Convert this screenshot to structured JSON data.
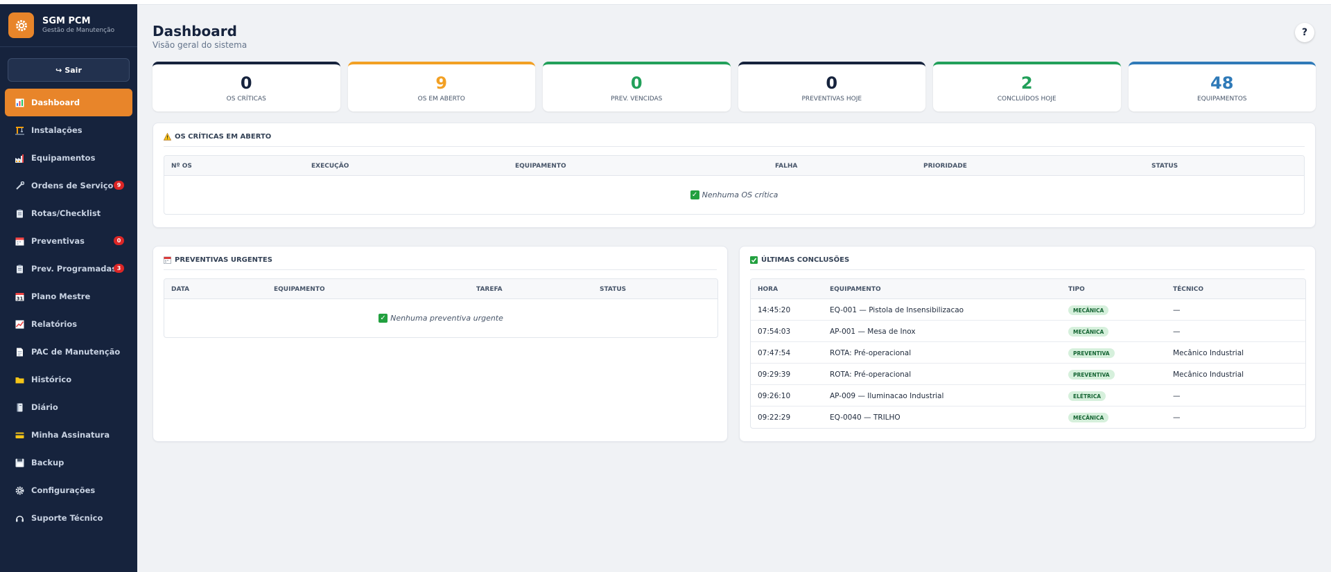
{
  "brand": {
    "title": "SGM PCM",
    "subtitle": "Gestão de Manutenção"
  },
  "logout_label": "Sair",
  "nav": [
    {
      "label": "Dashboard",
      "icon": "bar-chart-icon",
      "active": true
    },
    {
      "label": "Instalações",
      "icon": "crane-icon"
    },
    {
      "label": "Equipamentos",
      "icon": "factory-icon"
    },
    {
      "label": "Ordens de Serviço",
      "icon": "wrench-icon",
      "badge": "9"
    },
    {
      "label": "Rotas/Checklist",
      "icon": "clipboard-icon"
    },
    {
      "label": "Preventivas",
      "icon": "calendar-icon",
      "badge": "0"
    },
    {
      "label": "Prev. Programadas",
      "icon": "clipboard-icon",
      "badge": "3"
    },
    {
      "label": "Plano Mestre",
      "icon": "calendar-31-icon"
    },
    {
      "label": "Relatórios",
      "icon": "line-chart-icon"
    },
    {
      "label": "PAC de Manutenção",
      "icon": "document-icon"
    },
    {
      "label": "Histórico",
      "icon": "folder-icon"
    },
    {
      "label": "Diário",
      "icon": "notebook-icon"
    },
    {
      "label": "Minha Assinatura",
      "icon": "credit-card-icon"
    },
    {
      "label": "Backup",
      "icon": "floppy-disk-icon"
    },
    {
      "label": "Configurações",
      "icon": "gear-icon"
    },
    {
      "label": "Suporte Técnico",
      "icon": "headset-icon"
    }
  ],
  "header": {
    "title": "Dashboard",
    "subtitle": "Visão geral do sistema",
    "help": "?"
  },
  "stats": [
    {
      "value": "0",
      "label": "OS CRÍTICAS",
      "color": "#16233d"
    },
    {
      "value": "9",
      "label": "OS EM ABERTO",
      "color": "#f2a024"
    },
    {
      "value": "0",
      "label": "PREV. VENCIDAS",
      "color": "#22a05a"
    },
    {
      "value": "0",
      "label": "PREVENTIVAS HOJE",
      "color": "#16233d"
    },
    {
      "value": "2",
      "label": "CONCLUÍDOS HOJE",
      "color": "#22a05a"
    },
    {
      "value": "48",
      "label": "EQUIPAMENTOS",
      "color": "#2f7ab8"
    }
  ],
  "critical": {
    "title": "OS CRÍTICAS EM ABERTO",
    "columns": [
      "Nº OS",
      "EXECUÇÃO",
      "EQUIPAMENTO",
      "FALHA",
      "PRIORIDADE",
      "STATUS"
    ],
    "empty": "Nenhuma OS crítica"
  },
  "urgent": {
    "title": "PREVENTIVAS URGENTES",
    "columns": [
      "DATA",
      "EQUIPAMENTO",
      "TAREFA",
      "STATUS"
    ],
    "empty": "Nenhuma preventiva urgente"
  },
  "latest": {
    "title": "ÚLTIMAS CONCLUSÕES",
    "columns": [
      "HORA",
      "EQUIPAMENTO",
      "TIPO",
      "TÉCNICO"
    ],
    "rows": [
      {
        "hora": "14:45:20",
        "equipamento": "EQ-001 — Pistola de Insensibilizacao",
        "tipo": "MECÂNICA",
        "tecnico": "—"
      },
      {
        "hora": "07:54:03",
        "equipamento": "AP-001 — Mesa de Inox",
        "tipo": "MECÂNICA",
        "tecnico": "—"
      },
      {
        "hora": "07:47:54",
        "equipamento": "ROTA: Pré-operacional",
        "tipo": "PREVENTIVA",
        "tecnico": "Mecânico Industrial"
      },
      {
        "hora": "09:29:39",
        "equipamento": "ROTA: Pré-operacional",
        "tipo": "PREVENTIVA",
        "tecnico": "Mecânico Industrial"
      },
      {
        "hora": "09:26:10",
        "equipamento": "AP-009 — Iluminacao Industrial",
        "tipo": "ELÉTRICA",
        "tecnico": "—"
      },
      {
        "hora": "09:22:29",
        "equipamento": "EQ-0040 — TRILHO",
        "tipo": "MECÂNICA",
        "tecnico": "—"
      }
    ]
  }
}
